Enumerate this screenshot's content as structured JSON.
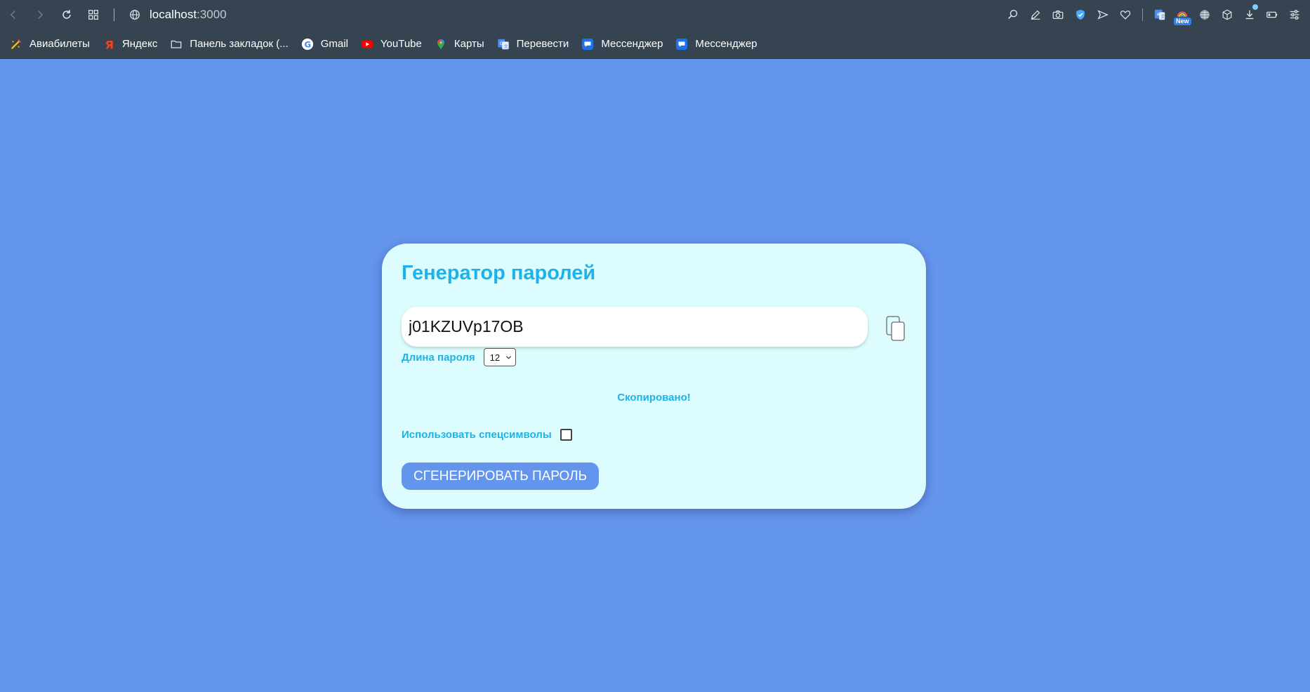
{
  "browser": {
    "url_host": "localhost",
    "url_port": ":3000",
    "bookmarks": [
      {
        "label": "Авиабилеты",
        "icon": "plane-ticket-icon"
      },
      {
        "label": "Яндекс",
        "icon": "yandex-icon"
      },
      {
        "label": "Панель закладок (...",
        "icon": "folder-icon"
      },
      {
        "label": "Gmail",
        "icon": "google-icon"
      },
      {
        "label": "YouTube",
        "icon": "youtube-icon"
      },
      {
        "label": "Карты",
        "icon": "maps-pin-icon"
      },
      {
        "label": "Перевести",
        "icon": "translate-icon"
      },
      {
        "label": "Мессенджер",
        "icon": "messenger-icon"
      },
      {
        "label": "Мессенджер",
        "icon": "messenger-icon"
      }
    ],
    "extension_badge": "New"
  },
  "app": {
    "title": "Генератор паролей",
    "password_value": "j01KZUVp17OB",
    "length_label": "Длина пароля",
    "length_value": "12",
    "copied_status": "Скопировано!",
    "special_chars_label": "Использовать спецсимволы",
    "special_chars_checked": false,
    "generate_button": "СГЕНЕРИРОВАТЬ ПАРОЛЬ"
  },
  "colors": {
    "page_background": "#6495ed",
    "card_background": "#dcfcfd",
    "accent_text": "#1eb3e8",
    "browser_chrome": "#364350"
  }
}
